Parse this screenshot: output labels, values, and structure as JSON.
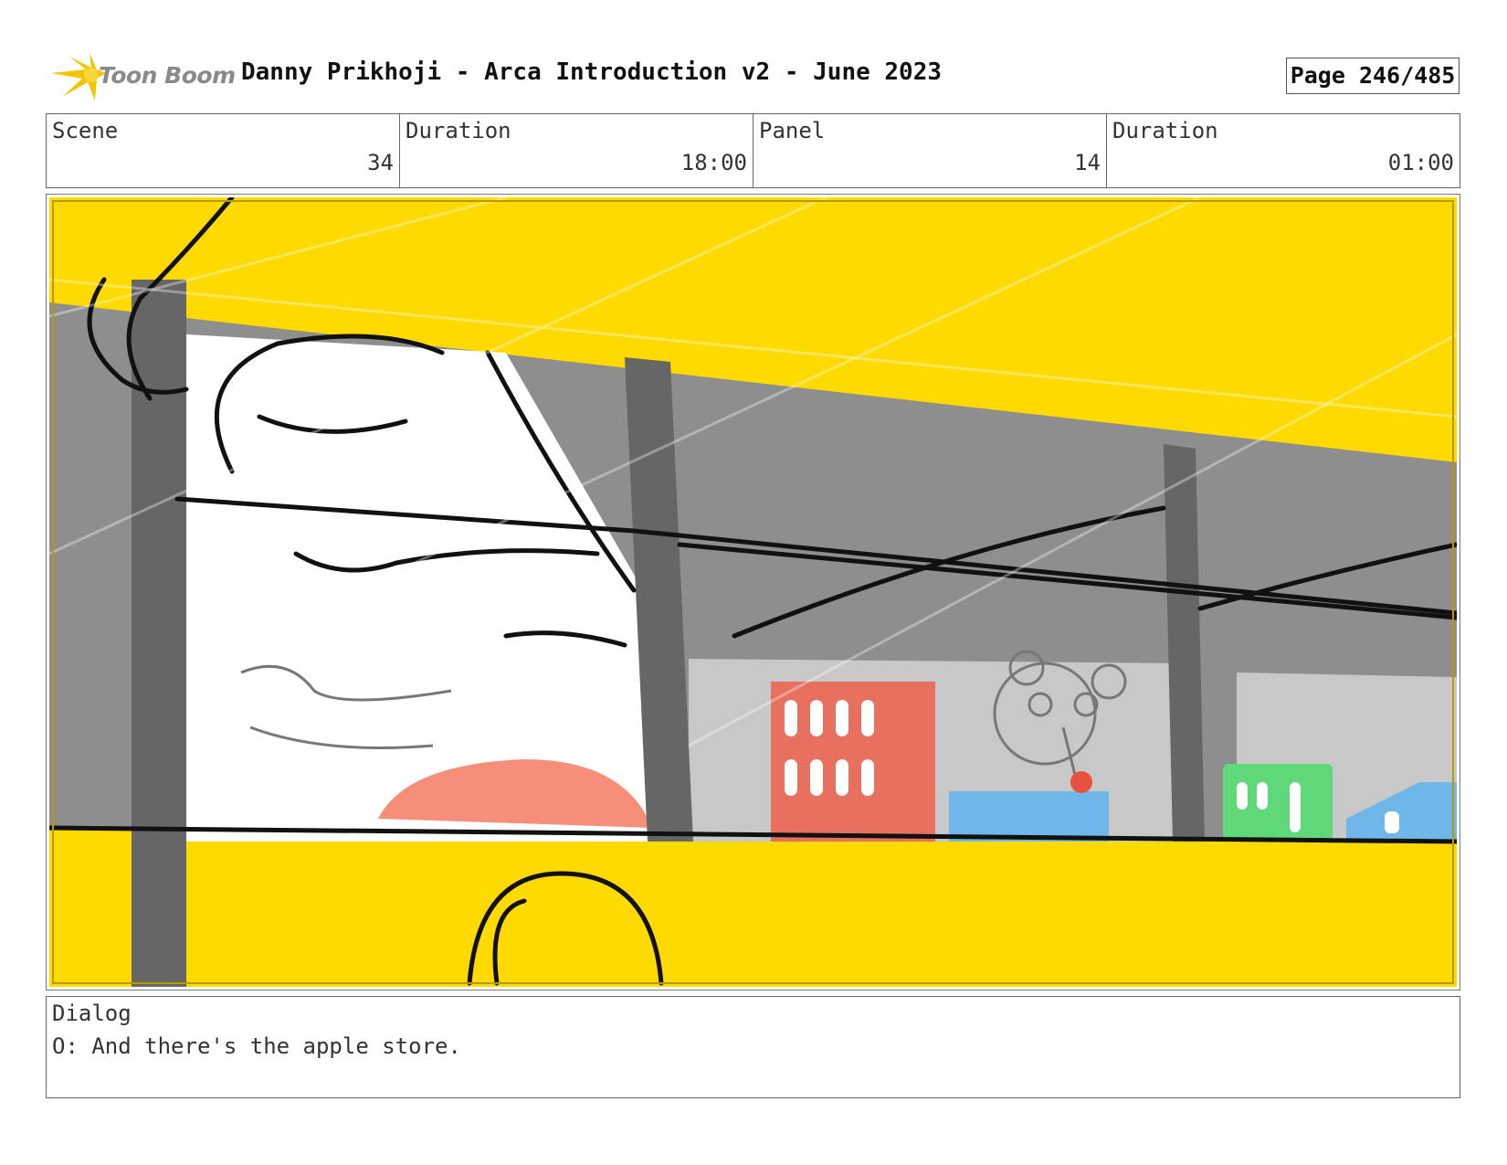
{
  "header": {
    "brand": "Toon Boom",
    "title": "Danny Prikhoji - Arca Introduction v2 - June 2023",
    "page": "Page 246/485"
  },
  "info": {
    "scene_label": "Scene",
    "scene_value": "34",
    "scene_duration_label": "Duration",
    "scene_duration_value": "18:00",
    "panel_label": "Panel",
    "panel_value": "14",
    "panel_duration_label": "Duration",
    "panel_duration_value": "01:00"
  },
  "dialog": {
    "label": "Dialog",
    "text": "O: And there's the apple store."
  },
  "colors": {
    "bus_yellow": "#FFDA00",
    "window_gray": "#8E8E8E",
    "store_red": "#E8705E",
    "store_blue": "#6FB7E8",
    "store_green": "#5FD87A",
    "logo_yellow": "#F5C400"
  }
}
